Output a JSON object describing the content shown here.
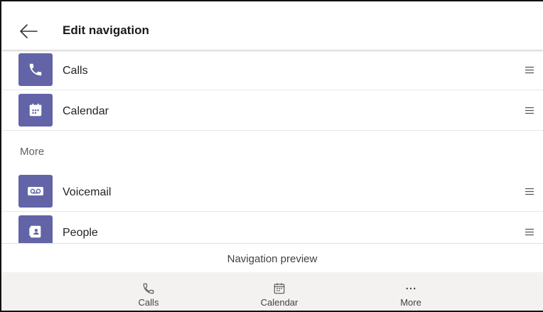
{
  "header": {
    "title": "Edit navigation",
    "back_icon": "arrow-left-icon"
  },
  "apps": [
    {
      "label": "Calls",
      "icon": "phone-icon"
    },
    {
      "label": "Calendar",
      "icon": "calendar-icon"
    }
  ],
  "more": {
    "label": "More",
    "apps": [
      {
        "label": "Voicemail",
        "icon": "voicemail-icon"
      },
      {
        "label": "People",
        "icon": "contact-card-icon"
      }
    ]
  },
  "preview": {
    "label": "Navigation preview",
    "items": [
      {
        "label": "Calls",
        "icon": "phone-icon"
      },
      {
        "label": "Calendar",
        "icon": "calendar-icon"
      },
      {
        "label": "More",
        "icon": "more-dots-icon"
      }
    ]
  },
  "colors": {
    "app_tile": "#6264a7",
    "nav_background": "#f3f2f1"
  }
}
